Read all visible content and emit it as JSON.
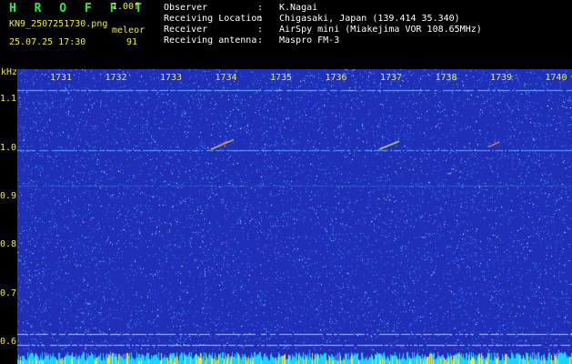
{
  "app": {
    "title": "H R O F F T",
    "version": "1.00f",
    "filename": "KN9_2507251730.png",
    "mode": "meleor",
    "datetime": "25.07.25 17:30",
    "count": "91"
  },
  "info": [
    {
      "key": "Observer",
      "value": "K.Nagai"
    },
    {
      "key": "Receiving Location",
      "value": "Chigasaki, Japan (139.414 35.340)"
    },
    {
      "key": "Receiver",
      "value": "AirSpy mini (Miakejima VOR 108.65MHz)"
    },
    {
      "key": "Receiving antenna",
      "value": "Maspro FM-3"
    }
  ],
  "chart_data": {
    "type": "heatmap",
    "xlabel": "",
    "ylabel": "kHz",
    "x_ticks": [
      "1731",
      "1732",
      "1733",
      "1734",
      "1735",
      "1736",
      "1737",
      "1738",
      "1739",
      "1740"
    ],
    "y_ticks": [
      "1.1",
      "1.0",
      "0.9",
      "0.8",
      "0.7",
      "0.6"
    ],
    "ylim": [
      0.58,
      1.16
    ],
    "colors": {
      "background": "#1f2fb8",
      "noise": "#4aa8ff",
      "signal": "#2ef0ff",
      "meteor": "#f6e43a",
      "bottom_band": "#19d4ff"
    }
  }
}
